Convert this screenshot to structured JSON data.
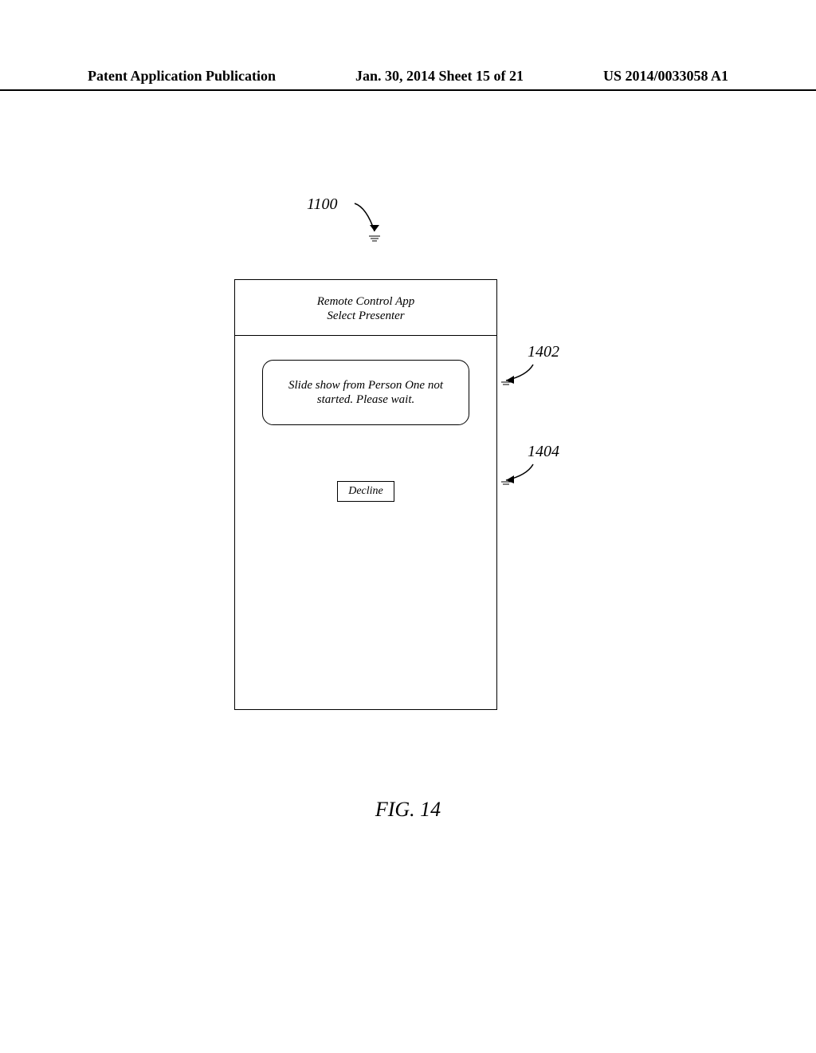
{
  "header": {
    "left": "Patent Application Publication",
    "center": "Jan. 30, 2014  Sheet 15 of 21",
    "right": "US 2014/0033058 A1"
  },
  "refs": {
    "r1100": "1100",
    "r1402": "1402",
    "r1404": "1404"
  },
  "device": {
    "title_line1": "Remote Control App",
    "title_line2": "Select Presenter",
    "message_line1": "Slide show from Person One not",
    "message_line2": "started. Please wait.",
    "decline_label": "Decline"
  },
  "figure": {
    "caption": "FIG. 14"
  }
}
